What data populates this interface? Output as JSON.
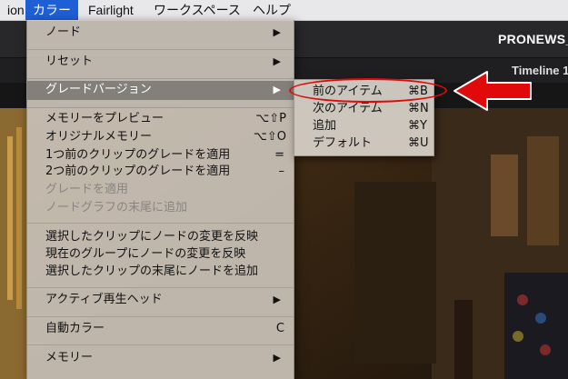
{
  "menubar": {
    "items": [
      {
        "label": "ion"
      },
      {
        "label": "カラー"
      },
      {
        "label": "Fairlight"
      },
      {
        "label": "ワークスペース"
      },
      {
        "label": "ヘルプ"
      }
    ]
  },
  "window": {
    "project_title": "PRONEWS_",
    "timeline_label": "Timeline 1"
  },
  "color_menu": {
    "items": [
      {
        "label": "ノード",
        "submenu": true
      },
      {
        "label": "リセット",
        "submenu": true
      },
      {
        "label": "グレードバージョン",
        "submenu": true,
        "highlighted": true
      },
      {
        "label": "メモリーをプレビュー",
        "shortcut": "⌥⇧P"
      },
      {
        "label": "オリジナルメモリー",
        "shortcut": "⌥⇧O"
      },
      {
        "label": "1つ前のクリップのグレードを適用",
        "shortcut": "="
      },
      {
        "label": "2つ前のクリップのグレードを適用",
        "shortcut": "–"
      },
      {
        "label": "グレードを適用",
        "disabled": true
      },
      {
        "label": "ノードグラフの末尾に追加",
        "disabled": true
      },
      {
        "label": "選択したクリップにノードの変更を反映"
      },
      {
        "label": "現在のグループにノードの変更を反映"
      },
      {
        "label": "選択したクリップの末尾にノードを追加"
      },
      {
        "label": "アクティブ再生ヘッド",
        "submenu": true
      },
      {
        "label": "自動カラー",
        "shortcut": "C"
      },
      {
        "label": "メモリー",
        "submenu": true
      }
    ]
  },
  "grade_version_submenu": {
    "items": [
      {
        "label": "前のアイテム",
        "shortcut": "⌘B"
      },
      {
        "label": "次のアイテム",
        "shortcut": "⌘N"
      },
      {
        "label": "追加",
        "shortcut": "⌘Y"
      },
      {
        "label": "デフォルト",
        "shortcut": "⌘U"
      }
    ]
  },
  "icons": {
    "submenu_arrow": "submenu-arrow-icon",
    "callout_arrow": "callout-arrow-icon"
  },
  "colors": {
    "menubar_active": "#1f5fd6",
    "annotation_red": "#e10a0a",
    "highlight_row": "#83807c"
  }
}
